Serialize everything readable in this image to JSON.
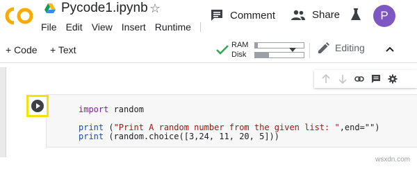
{
  "app": {
    "logo_text": "CO",
    "notebook_title": "Pycode1.ipynb"
  },
  "menu": {
    "items": [
      "File",
      "Edit",
      "View",
      "Insert",
      "Runtime"
    ]
  },
  "header_actions": {
    "comment_label": "Comment",
    "share_label": "Share",
    "avatar_letter": "P"
  },
  "toolbar": {
    "add_code_label": "+ Code",
    "add_text_label": "+ Text",
    "ram_label": "RAM",
    "disk_label": "Disk",
    "ram_usage_fraction": 0.06,
    "disk_usage_fraction": 0.28,
    "editing_label": "Editing"
  },
  "cell": {
    "code_lines": [
      "import random",
      "",
      "print (\"Print A random number from the given list: \",end=\"\")",
      "print (random.choice([3,24, 11, 20, 5]))"
    ]
  },
  "watermark": "wsxdn.com",
  "colors": {
    "logo_orange": "#f9ab00",
    "avatar_purple": "#7e57c2",
    "check_green": "#34a853",
    "highlight_yellow": "#f4e20f",
    "keyword_purple": "#7c1fa2",
    "string_red": "#a31515"
  },
  "icons": {
    "title": "drive-icon",
    "star": "star-outline-icon",
    "comment": "comment-icon",
    "share": "people-icon",
    "labs": "flask-icon",
    "connected": "check-icon",
    "editing": "pencil-icon",
    "collapse": "chevron-up-icon",
    "run": "play-icon"
  }
}
